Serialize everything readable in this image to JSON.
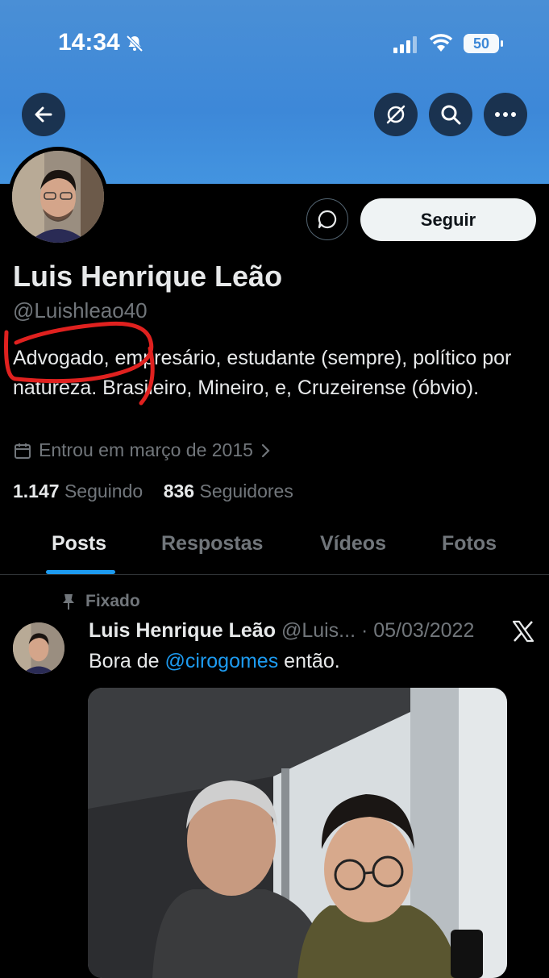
{
  "status_bar": {
    "time": "14:34",
    "battery": "50",
    "icons": [
      "bell-muted-icon",
      "signal-icon",
      "wifi-icon",
      "battery-icon"
    ]
  },
  "header": {
    "buttons": [
      "back-icon",
      "grok-icon",
      "search-icon",
      "more-icon"
    ]
  },
  "profile": {
    "follow_label": "Seguir",
    "name": "Luis Henrique Leão",
    "handle": "@Luishleao40",
    "bio": "Advogado, empresário, estudante (sempre), político por natureza. Brasileiro, Mineiro, e, Cruzeirense (óbvio).",
    "joined": "Entrou em março de 2015",
    "following_count": "1.147",
    "following_label": "Seguindo",
    "followers_count": "836",
    "followers_label": "Seguidores"
  },
  "tabs": [
    {
      "label": "Posts"
    },
    {
      "label": "Respostas"
    },
    {
      "label": "Vídeos"
    },
    {
      "label": "Fotos"
    }
  ],
  "pinned_tweet": {
    "pinned_label": "Fixado",
    "author_name": "Luis Henrique Leão",
    "author_handle": "@Luis...",
    "date": "· 05/03/2022",
    "text_before": "Bora de ",
    "mention": "@cirogomes",
    "text_after": " então."
  },
  "colors": {
    "banner": "#4a8fd6",
    "accent": "#1d9bf0",
    "annotation": "#e0211f"
  }
}
